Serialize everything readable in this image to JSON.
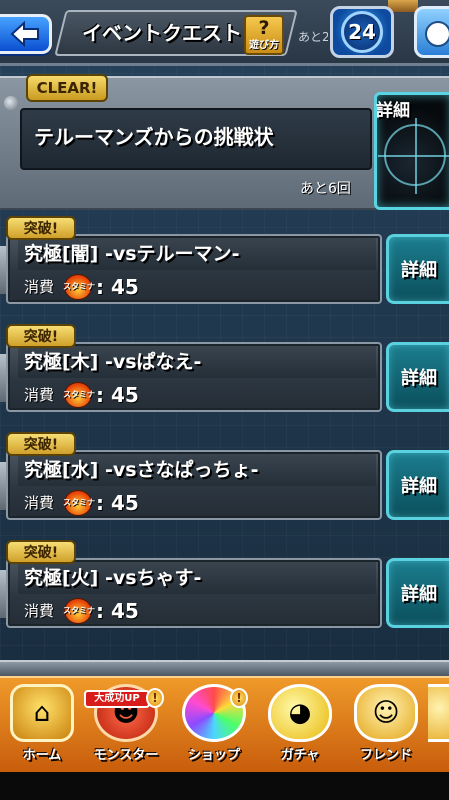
{
  "header": {
    "title": "イベントクエスト",
    "help_symbol": "?",
    "help_label": "遊び方",
    "remaining_text": "あと2",
    "stamina_value": "24"
  },
  "event": {
    "clear_badge": "CLEAR!",
    "title": "テルーマンズからの挑戦状",
    "remaining": "あと6回",
    "detail_label": "詳細"
  },
  "quests": [
    {
      "badge": "突破!",
      "name": "究極[闇] -vsテルーマン-",
      "cost_label": "消費",
      "stamina_text": "スタミナ",
      "cost": ": 45",
      "detail": "詳細"
    },
    {
      "badge": "突破!",
      "name": "究極[木] -vsぱなえ-",
      "cost_label": "消費",
      "stamina_text": "スタミナ",
      "cost": ": 45",
      "detail": "詳細"
    },
    {
      "badge": "突破!",
      "name": "究極[水] -vsさなぱっちょ-",
      "cost_label": "消費",
      "stamina_text": "スタミナ",
      "cost": ": 45",
      "detail": "詳細"
    },
    {
      "badge": "突破!",
      "name": "究極[火] -vsちゃす-",
      "cost_label": "消費",
      "stamina_text": "スタミナ",
      "cost": ": 45",
      "detail": "詳細"
    }
  ],
  "tabbar": {
    "items": [
      {
        "label": "ホーム",
        "icon": "home-icon"
      },
      {
        "label": "モンスター",
        "icon": "monster-icon",
        "badge": "大成功UP",
        "notice": "!"
      },
      {
        "label": "ショップ",
        "icon": "shop-orb-icon",
        "notice": "!"
      },
      {
        "label": "ガチャ",
        "icon": "gacha-egg-icon"
      },
      {
        "label": "フレンド",
        "icon": "friend-icon"
      }
    ]
  },
  "colors": {
    "accent_teal": "#59d1df",
    "badge_gold": "#f7de73",
    "tabbar_orange": "#ef9a2a",
    "back_blue": "#0b4fd1"
  }
}
